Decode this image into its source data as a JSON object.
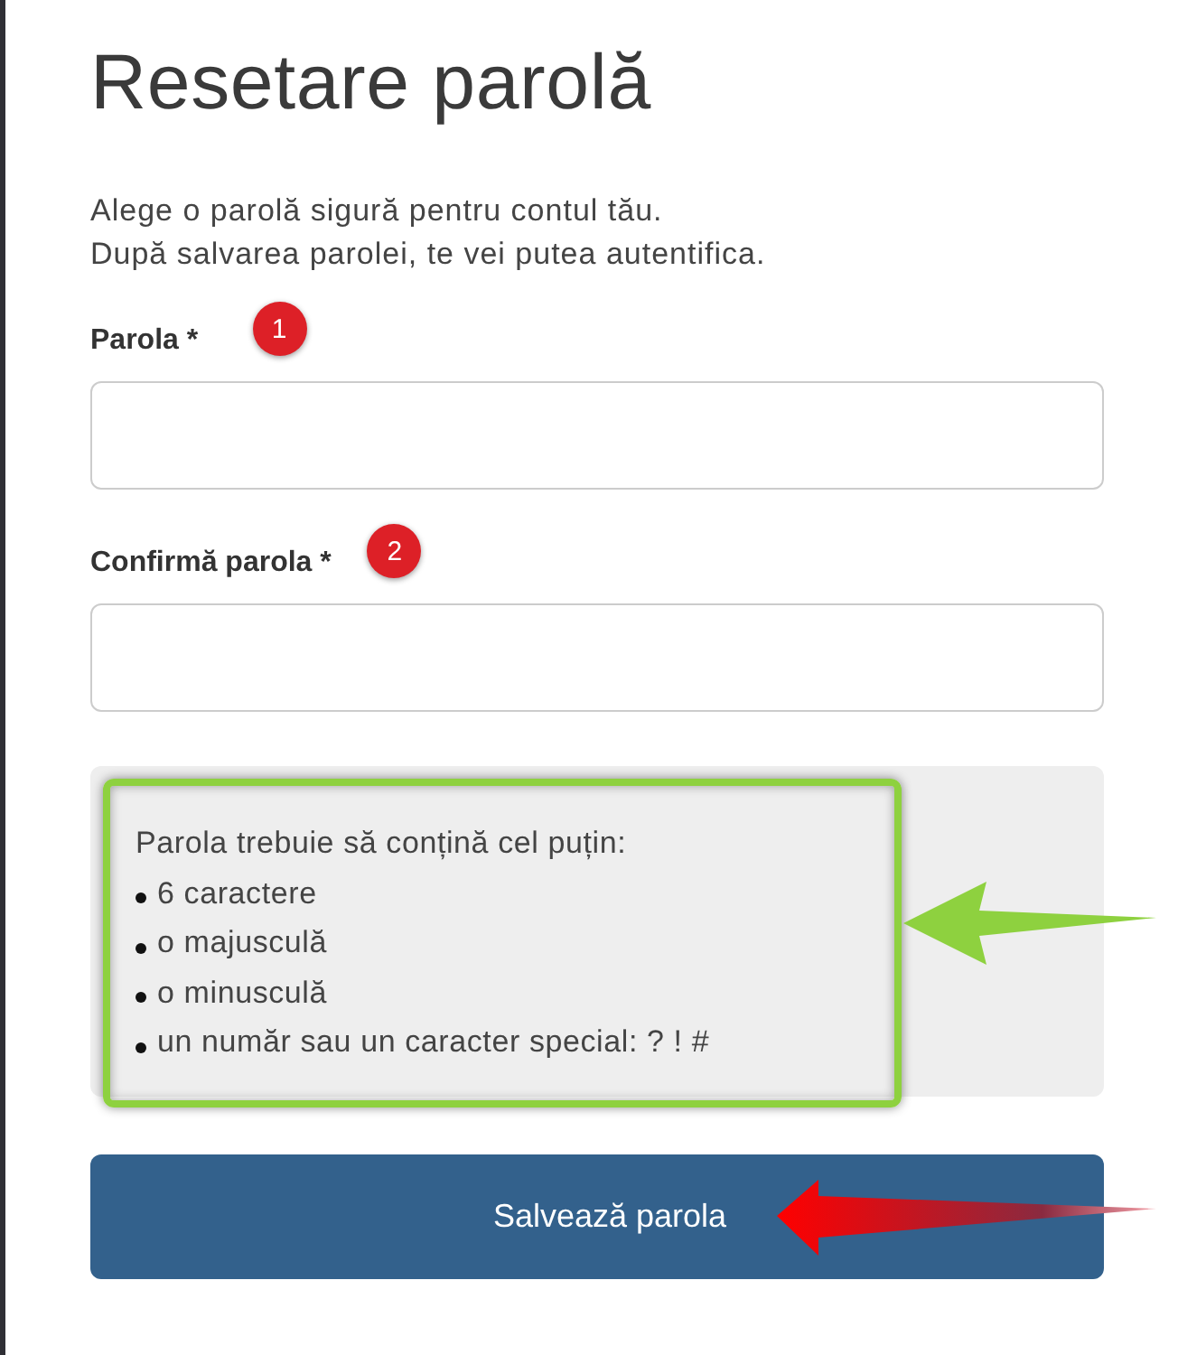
{
  "title": "Resetare parolă",
  "intro": [
    "Alege o parolă sigură pentru contul tău.",
    "După salvarea parolei, te vei putea autentifica."
  ],
  "fields": [
    {
      "label": "Parola *",
      "marker": "1"
    },
    {
      "label": "Confirmă parola *",
      "marker": "2"
    }
  ],
  "requirements": {
    "heading": "Parola trebuie să conțină cel puțin:",
    "items": [
      "6 caractere",
      "o majusculă",
      "o minusculă",
      "un număr sau un caracter special: ? ! #"
    ],
    "highlighted": true,
    "arrow": true
  },
  "button": {
    "label": "Salvează parola",
    "arrow": true
  }
}
